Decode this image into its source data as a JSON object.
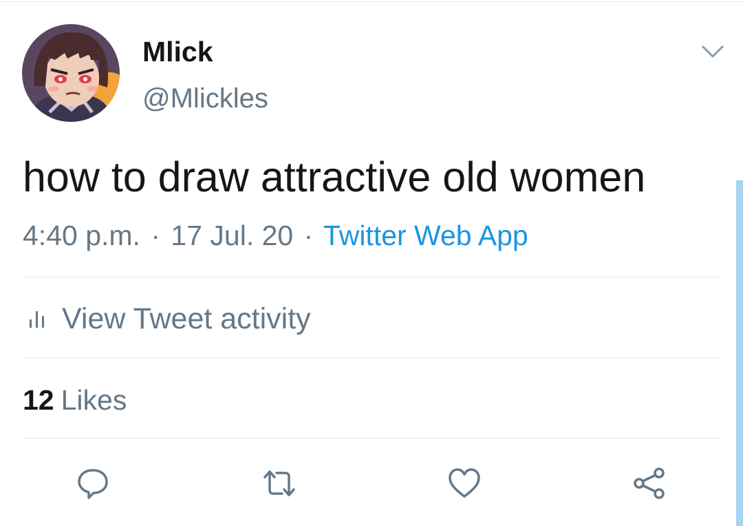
{
  "tweet": {
    "author": {
      "display_name": "Mlick",
      "handle": "@Mlickles",
      "avatar_icon": "avatar-illustration"
    },
    "menu_icon": "chevron-down-icon",
    "text": "how to draw attractive old women",
    "meta": {
      "time": "4:40 p.m.",
      "separator": "·",
      "date": "17 Jul. 20",
      "source": "Twitter Web App"
    },
    "activity": {
      "icon": "bar-chart-icon",
      "label": "View Tweet activity"
    },
    "likes": {
      "count": "12",
      "label": "Likes"
    },
    "actions": [
      {
        "name": "reply",
        "icon": "reply-bubble-icon"
      },
      {
        "name": "retweet",
        "icon": "retweet-icon"
      },
      {
        "name": "like",
        "icon": "heart-icon"
      },
      {
        "name": "share",
        "icon": "share-icon"
      }
    ]
  },
  "colors": {
    "text_primary": "#14171a",
    "text_secondary": "#657786",
    "link_blue": "#1b95e0",
    "divider": "#e1e8ed",
    "scrollbar": "#a8d3f2"
  }
}
